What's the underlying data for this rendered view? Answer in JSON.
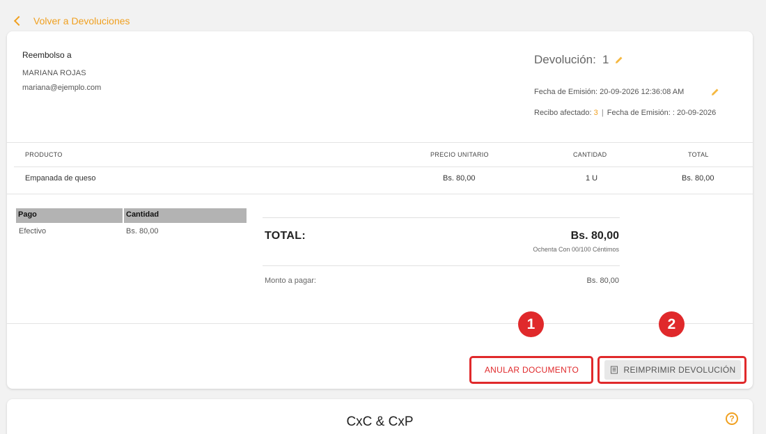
{
  "nav": {
    "back_label": "Volver a Devoluciones"
  },
  "customer": {
    "section_label": "Reembolso a",
    "name": "MARIANA ROJAS",
    "email": "mariana@ejemplo.com"
  },
  "document": {
    "title": "Devolución:",
    "number": "1",
    "issue_label": "Fecha de Emisión:",
    "issue_date": "20-09-2026 12:36:08 AM",
    "receipt_label": "Recibo afectado:",
    "receipt_number": "3",
    "receipt_separator": "|",
    "receipt_issue_label": "Fecha de Emisión: :",
    "receipt_issue_date": "20-09-2026"
  },
  "products": {
    "headers": {
      "product": "PRODUCTO",
      "unit_price": "PRECIO UNITARIO",
      "quantity": "CANTIDAD",
      "total": "TOTAL"
    },
    "rows": [
      {
        "product": "Empanada de queso",
        "unit_price": "Bs. 80,00",
        "quantity": "1 U",
        "total": "Bs. 80,00"
      }
    ]
  },
  "payments": {
    "headers": {
      "method": "Pago",
      "amount": "Cantidad"
    },
    "rows": [
      {
        "method": "Efectivo",
        "amount": "Bs. 80,00"
      }
    ]
  },
  "summary": {
    "total_label": "TOTAL:",
    "total_value": "Bs. 80,00",
    "total_words": "Ochenta Con 00/100 Céntimos",
    "pay_label": "Monto a pagar:",
    "pay_value": "Bs. 80,00"
  },
  "annotations": {
    "badge1": "1",
    "badge2": "2",
    "color": "#e0292b"
  },
  "actions": {
    "void_label": "ANULAR DOCUMENTO",
    "reprint_label": "REIMPRIMIR DEVOLUCIÓN"
  },
  "second_card": {
    "title": "CxC & CxP",
    "help_glyph": "?"
  },
  "colors": {
    "accent": "#f0a020",
    "danger": "#e0292b"
  },
  "icons": {
    "back": "chevron-left-icon",
    "edit": "pencil-icon",
    "reprint": "document-icon",
    "help": "help-circle-icon"
  }
}
